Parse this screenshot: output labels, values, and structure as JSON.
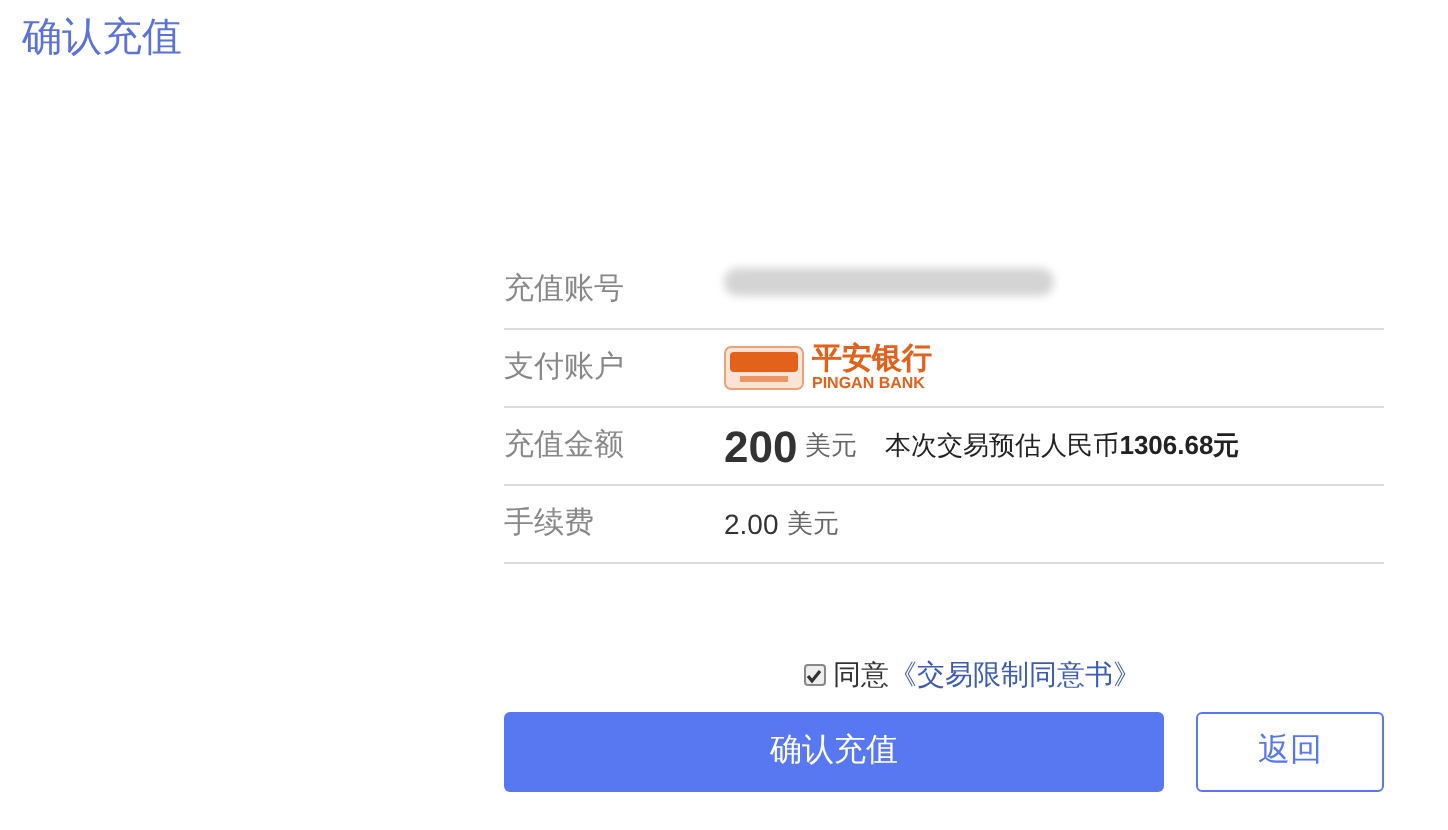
{
  "page_title": "确认充值",
  "rows": [
    {
      "kind": "masked",
      "label": "充值账号"
    },
    {
      "kind": "bank",
      "label": "支付账户",
      "bank_name": "平安银行",
      "bank_name_en": "PINGAN BANK"
    },
    {
      "kind": "amount",
      "label": "充值金额",
      "amount": "200",
      "currency": "美元",
      "estimate": "本次交易预估人民币**1306.68元**"
    },
    {
      "kind": "fee",
      "label": "手续费",
      "value": "2.00",
      "currency": "美元"
    }
  ],
  "agreement": {
    "checked": true,
    "prefix": "同意",
    "link": "《交易限制同意书》"
  },
  "buttons": {
    "confirm": "确认充值",
    "back": "返回"
  }
}
